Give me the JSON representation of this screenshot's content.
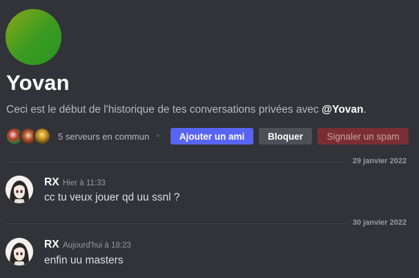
{
  "profile": {
    "name": "Yovan",
    "intro_prefix": "Ceci est le début de l'historique de tes conversations privées avec ",
    "intro_mention": "@Yovan",
    "intro_suffix": ".",
    "avatar_colors": [
      "#8aa617",
      "#27951e"
    ]
  },
  "mutual_servers": {
    "label": "5 serveurs en commun",
    "icons": [
      "server-icon-1",
      "server-icon-2",
      "server-icon-3"
    ]
  },
  "actions": {
    "add_friend": "Ajouter un ami",
    "block": "Bloquer",
    "report_spam": "Signaler un spam"
  },
  "messages": [
    {
      "date_divider": "29 janvier 2022",
      "author": "RX",
      "timestamp": "Hier à 11:33",
      "content": "cc tu veux jouer qd uu ssnl ?"
    },
    {
      "date_divider": "30 janvier 2022",
      "author": "RX",
      "timestamp": "Aujourd'hui à 18:23",
      "content": "enfin uu masters"
    }
  ],
  "colors": {
    "background": "#313338",
    "primary_button": "#5865f2",
    "secondary_button": "#4e5058",
    "danger_button": "#7a2e33"
  }
}
